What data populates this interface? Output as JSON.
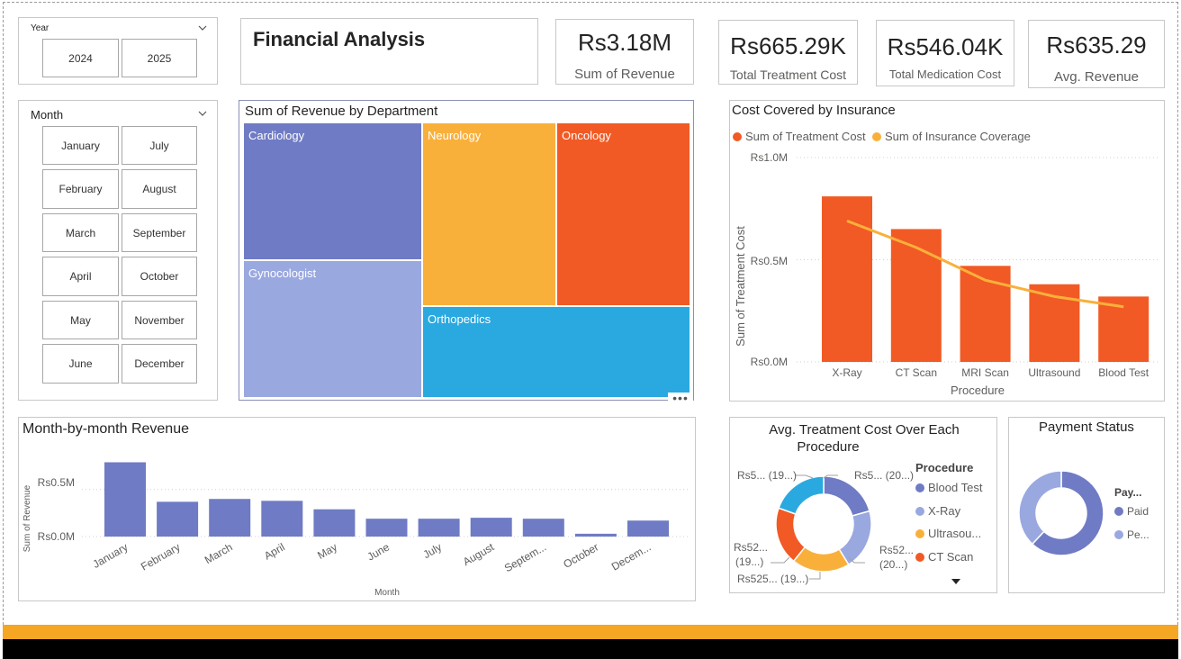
{
  "year_slicer": {
    "title": "Year",
    "options": [
      "2024",
      "2025"
    ]
  },
  "month_slicer": {
    "title": "Month",
    "options": [
      "January",
      "July",
      "February",
      "August",
      "March",
      "September",
      "April",
      "October",
      "May",
      "November",
      "June",
      "December"
    ]
  },
  "header": {
    "title": "Financial Analysis"
  },
  "kpis": [
    {
      "value": "Rs3.18M",
      "label": "Sum of Revenue"
    },
    {
      "value": "Rs665.29K",
      "label": "Total Treatment Cost"
    },
    {
      "value": "Rs546.04K",
      "label": "Total Medication Cost"
    },
    {
      "value": "Rs635.29",
      "label": "Avg. Revenue"
    }
  ],
  "treemap": {
    "title": "Sum of Revenue by Department",
    "more_icon": "more-options-icon",
    "labels": {
      "cardiology": "Cardiology",
      "neurology": "Neurology",
      "oncology": "Oncology",
      "gynocologist": "Gynocologist",
      "orthopedics": "Orthopedics"
    },
    "colors": {
      "cardiology": "#6f7bc4",
      "neurology": "#f9b03b",
      "oncology": "#f15a24",
      "gynocologist": "#9aa8e0",
      "orthopedics": "#2aa9e0"
    }
  },
  "insurance": {
    "title": "Cost Covered by Insurance",
    "ylabel": "Sum of Treatment Cost",
    "xlabel": "Procedure",
    "legend": [
      {
        "name": "Sum of Treatment Cost",
        "color": "#f15a24"
      },
      {
        "name": "Sum of Insurance Coverage",
        "color": "#f9b03b"
      }
    ],
    "yticks": [
      "Rs1.0M",
      "Rs0.5M",
      "Rs0.0M"
    ]
  },
  "monthly": {
    "title": "Month-by-month Revenue",
    "ylabel": "Sum of Revenue",
    "xlabel": "Month",
    "yticks": [
      "Rs0.5M",
      "Rs0.0M"
    ]
  },
  "donut_procedure": {
    "title_line1": "Avg. Treatment Cost Over Each",
    "title_line2": "Procedure",
    "legend_title": "Procedure",
    "legend": [
      {
        "name": "Blood Test",
        "color": "#6f7bc4"
      },
      {
        "name": "X-Ray",
        "color": "#9aa8e0"
      },
      {
        "name": "Ultrasou...",
        "color": "#f9b03b"
      },
      {
        "name": "CT Scan",
        "color": "#f15a24"
      }
    ],
    "callouts": {
      "top_left": "Rs5... (19...)",
      "top_right": "Rs5... (20...)",
      "left_1": "Rs52...",
      "left_2": "(19...)",
      "right_1": "Rs52...",
      "right_2": "(20...)",
      "bottom": "Rs525... (19...)"
    }
  },
  "payment": {
    "title": "Payment Status",
    "legend_title": "Pay...",
    "legend": [
      {
        "name": "Paid",
        "color": "#6f7bc4"
      },
      {
        "name": "Pe...",
        "color": "#9aa8e0"
      }
    ]
  },
  "chart_data": [
    {
      "type": "bar",
      "title": "Cost Covered by Insurance",
      "xlabel": "Procedure",
      "ylabel": "Sum of Treatment Cost",
      "categories": [
        "X-Ray",
        "CT Scan",
        "MRI Scan",
        "Ultrasound",
        "Blood Test"
      ],
      "series": [
        {
          "name": "Sum of Treatment Cost",
          "type": "bar",
          "color": "#f15a24",
          "values": [
            0.81,
            0.65,
            0.47,
            0.38,
            0.32
          ]
        },
        {
          "name": "Sum of Insurance Coverage",
          "type": "line",
          "color": "#f9b03b",
          "values": [
            0.69,
            0.56,
            0.4,
            0.32,
            0.27
          ]
        }
      ],
      "ylim": [
        0,
        1.0
      ],
      "yunit": "M",
      "legend": "top-left",
      "grid": true
    },
    {
      "type": "bar",
      "title": "Month-by-month Revenue",
      "xlabel": "Month",
      "ylabel": "Sum of Revenue",
      "categories": [
        "January",
        "February",
        "March",
        "April",
        "May",
        "June",
        "July",
        "August",
        "Septem...",
        "October",
        "Decem..."
      ],
      "values": [
        0.79,
        0.37,
        0.4,
        0.38,
        0.29,
        0.19,
        0.19,
        0.2,
        0.19,
        0.03,
        0.17
      ],
      "ylim": [
        0,
        0.9
      ],
      "yunit": "M",
      "color": "#6f7bc4",
      "grid": true
    },
    {
      "type": "pie",
      "title": "Avg. Treatment Cost Over Each Procedure",
      "labels": [
        "Blood Test",
        "X-Ray",
        "Ultrasound",
        "CT Scan",
        "MRI Scan"
      ],
      "values": [
        20,
        20,
        19,
        19,
        19
      ],
      "colors": [
        "#6f7bc4",
        "#9aa8e0",
        "#f9b03b",
        "#f15a24",
        "#2aa9e0"
      ],
      "donut": true
    },
    {
      "type": "pie",
      "title": "Payment Status",
      "labels": [
        "Paid",
        "Pending"
      ],
      "values": [
        62,
        38
      ],
      "colors": [
        "#6f7bc4",
        "#9aa8e0"
      ],
      "donut": true
    },
    {
      "type": "heatmap",
      "title": "Sum of Revenue by Department",
      "labels": [
        "Cardiology",
        "Gynocologist",
        "Neurology",
        "Oncology",
        "Orthopedics"
      ],
      "note": "treemap"
    }
  ]
}
